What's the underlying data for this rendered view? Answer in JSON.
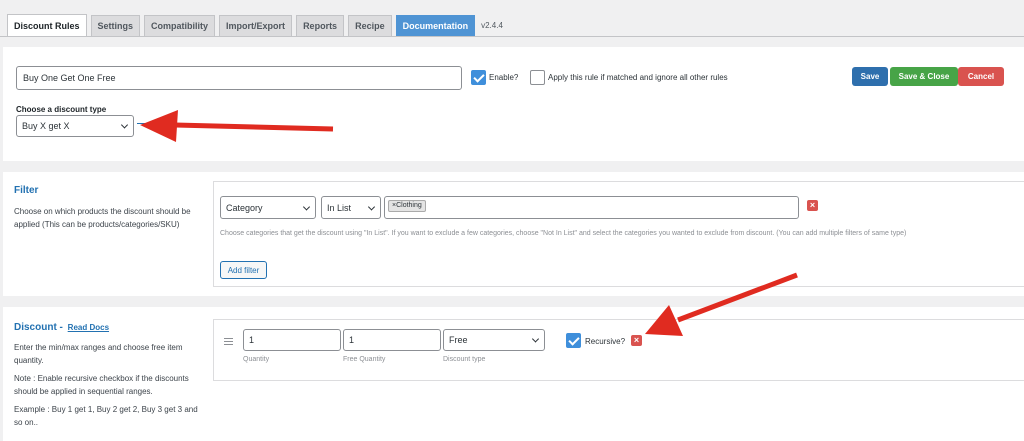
{
  "tabs": [
    {
      "label": "Discount Rules"
    },
    {
      "label": "Settings"
    },
    {
      "label": "Compatibility"
    },
    {
      "label": "Import/Export"
    },
    {
      "label": "Reports"
    },
    {
      "label": "Recipe"
    },
    {
      "label": "Documentation"
    }
  ],
  "version": "v2.4.4",
  "rule": {
    "title_value": "Buy One Get One Free",
    "enable_label": "Enable?",
    "exclusive_label": "Apply this rule if matched and ignore all other rules",
    "discount_type_label": "Choose a discount type",
    "discount_type_value": "Buy X get X"
  },
  "actions": {
    "save": "Save",
    "save_close": "Save & Close",
    "cancel": "Cancel"
  },
  "filter": {
    "heading": "Filter",
    "description": "Choose on which products the discount should be applied (This can be products/categories/SKU)",
    "type_value": "Category",
    "method_value": "In List",
    "tag": "Clothing",
    "hint": "Choose categories that get the discount using \"In List\". If you want to exclude a few categories, choose \"Not In List\" and select the categories you wanted to exclude from discount. (You can add multiple filters of same type)",
    "add_label": "Add filter"
  },
  "discount": {
    "heading": "Discount -",
    "read_docs": "Read Docs",
    "desc1": "Enter the min/max ranges and choose free item quantity.",
    "desc2": "Note : Enable recursive checkbox if the discounts should be applied in sequential ranges.",
    "desc3": "Example : Buy 1 get 1, Buy 2 get 2, Buy 3 get 3 and so on..",
    "quantity_value": "1",
    "quantity_label": "Quantity",
    "free_quantity_value": "1",
    "free_quantity_label": "Free Quantity",
    "discount_type_value": "Free",
    "discount_type_label": "Discount type",
    "recursive_label": "Recursive?"
  },
  "colors": {
    "accent": "#2271b1",
    "save": "#2e6fad",
    "save_close": "#47a447",
    "cancel": "#d9534f",
    "arrow": "#e02b20"
  }
}
